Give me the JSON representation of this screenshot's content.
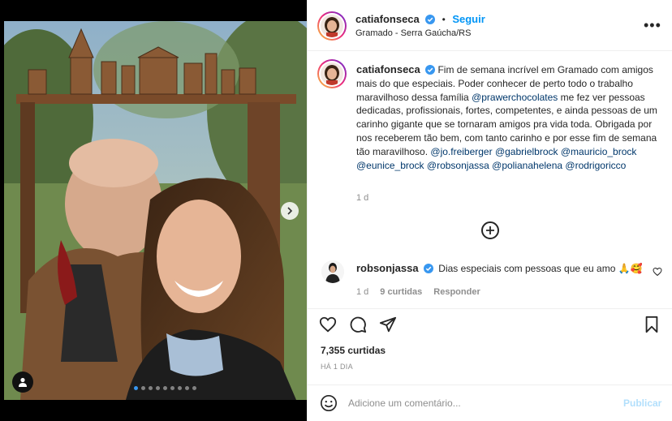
{
  "post": {
    "author": "catiafonseca",
    "follow_label": "Seguir",
    "location": "Gramado - Serra Gaúcha/RS",
    "more_label": "•••",
    "caption_parts": {
      "p1": "Fim de semana incrível em Gramado com amigos mais do que especiais. Poder conhecer de perto todo o trabalho maravilhoso dessa família ",
      "m1": "@prawerchocolates",
      "p2": " me fez ver pessoas dedicadas, profissionais, fortes, competentes, e ainda pessoas de um carinho gigante que se tornaram amigos pra vida toda. Obrigada por nos receberem tão bem, com tanto carinho e por esse fim de semana tão maravilhoso. ",
      "m2": "@jo.freiberger",
      "m3": "@gabrielbrock",
      "m4": "@mauricio_brock",
      "m5": "@eunice_brock",
      "m6": "@robsonjassa",
      "m7": "@polianahelena",
      "m8": "@rodrigoricco"
    },
    "caption_time": "1 d",
    "likes": "7,355 curtidas",
    "ago": "HÁ 1 DIA"
  },
  "comment": {
    "author": "robsonjassa",
    "text": "Dias especiais com pessoas que eu amo 🙏🥰",
    "time": "1 d",
    "likes": "9 curtidas",
    "reply_label": "Responder"
  },
  "add_comment": {
    "placeholder": "Adicione um comentário...",
    "publish_label": "Publicar"
  },
  "icons": {
    "heart": "heart-icon",
    "comment": "comment-icon",
    "share": "share-icon",
    "save": "bookmark-icon",
    "emoji": "emoji-icon",
    "plus": "load-more-icon",
    "user": "user-tag-icon",
    "next": "chevron-right-icon",
    "verified": "verified-badge-icon"
  },
  "colors": {
    "accent": "#0095f6",
    "mention": "#00376b",
    "muted": "#8e8e8e",
    "verified": "#3897f0"
  }
}
